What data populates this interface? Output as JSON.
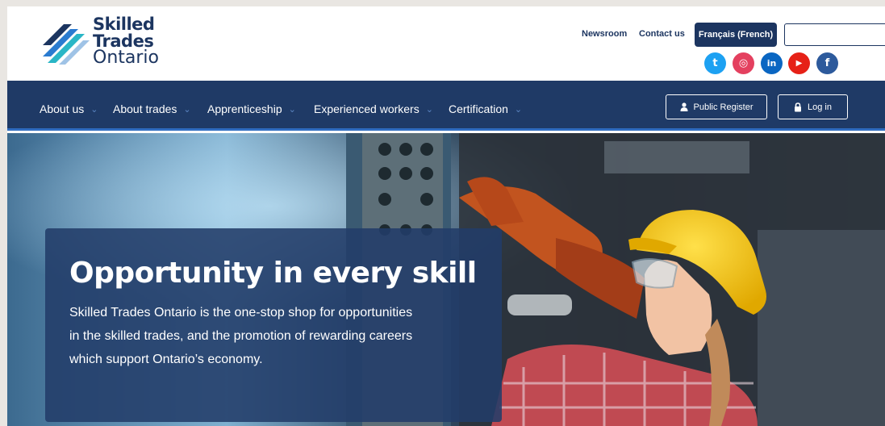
{
  "brand": {
    "line1": "Skilled",
    "line2": "Trades",
    "line3": "Ontario"
  },
  "utility": {
    "newsroom": "Newsroom",
    "contact": "Contact us",
    "language": "Français (French)",
    "search_value": ""
  },
  "social": [
    {
      "name": "twitter",
      "glyph": "t",
      "color": "#1da1f2"
    },
    {
      "name": "instagram",
      "glyph": "◎",
      "color": "#e4405f"
    },
    {
      "name": "linkedin",
      "glyph": "in",
      "color": "#0a66c2"
    },
    {
      "name": "youtube",
      "glyph": "▶",
      "color": "#e62117"
    },
    {
      "name": "facebook",
      "glyph": "f",
      "color": "#2d5a9c"
    }
  ],
  "nav": {
    "items": [
      {
        "label": "About us"
      },
      {
        "label": "About trades"
      },
      {
        "label": "Apprenticeship"
      },
      {
        "label": "Experienced workers"
      },
      {
        "label": "Certification"
      }
    ],
    "public_register": "Public Register",
    "login": "Log in"
  },
  "hero": {
    "title": "Opportunity in every skill",
    "line1": "Skilled Trades Ontario is the one-stop shop for opportunities",
    "line2": "in the skilled trades, and the promotion of rewarding careers",
    "line3": "which support Ontario’s economy."
  },
  "colors": {
    "navy": "#1c3560",
    "nav_bg": "#1f3a66",
    "accent_blue": "#2f6cc0",
    "helmet_yellow": "#f2c20f"
  }
}
